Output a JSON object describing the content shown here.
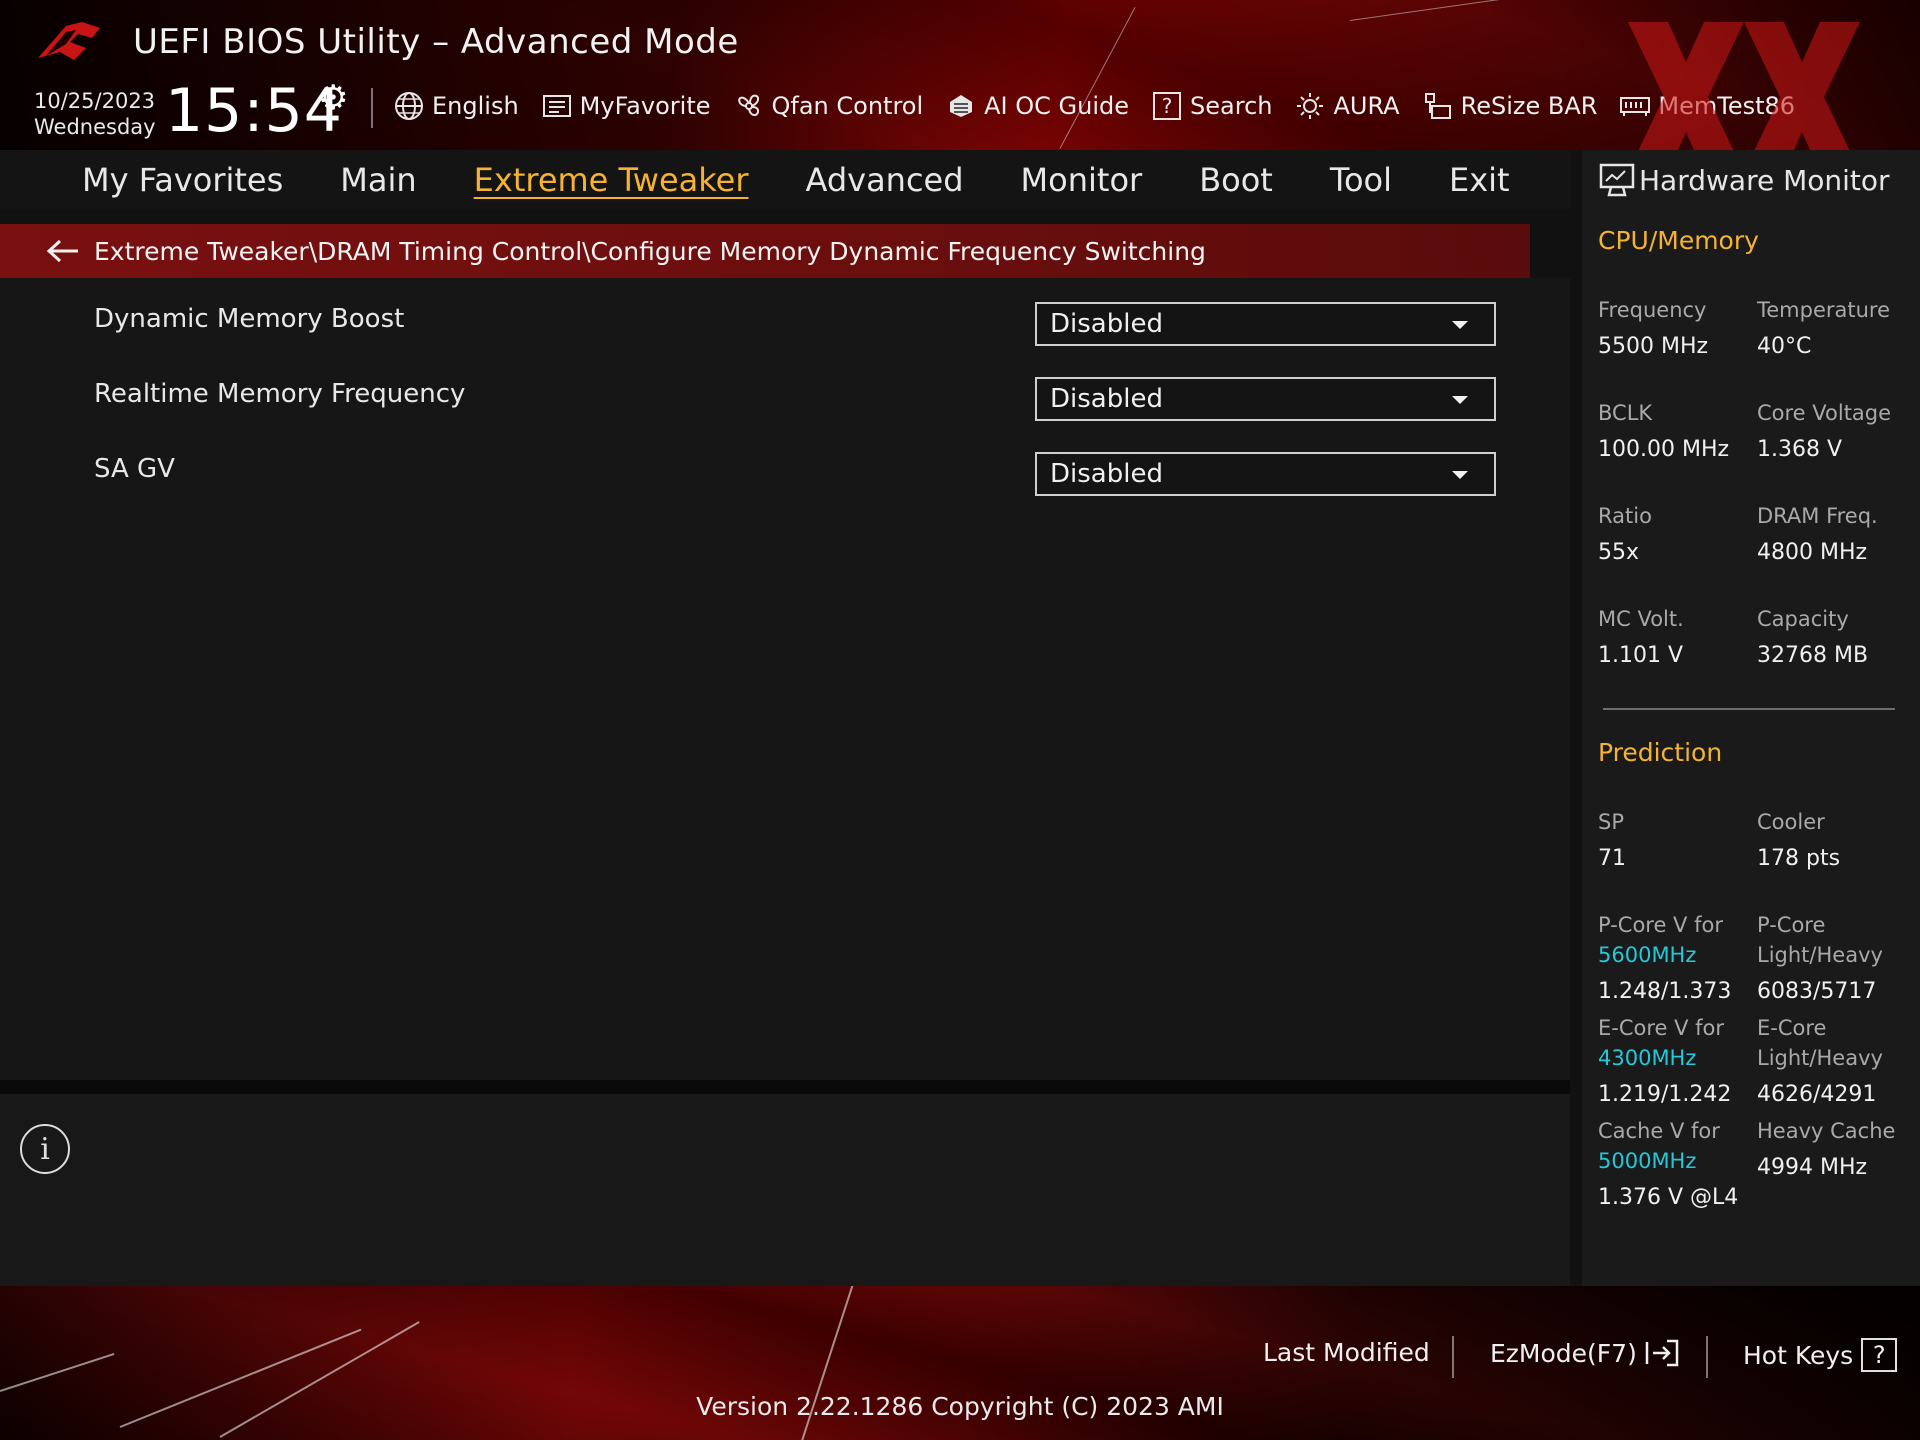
{
  "header": {
    "title": "UEFI BIOS Utility – Advanced Mode",
    "date": "10/25/2023",
    "weekday": "Wednesday",
    "time": "15:54",
    "tools": [
      {
        "label": "English",
        "icon": "globe-icon"
      },
      {
        "label": "MyFavorite",
        "icon": "favorite-list-icon"
      },
      {
        "label": "Qfan Control",
        "icon": "fan-icon"
      },
      {
        "label": "AI OC Guide",
        "icon": "ai-oc-icon"
      },
      {
        "label": "Search",
        "icon": "help-search-icon"
      },
      {
        "label": "AURA",
        "icon": "aura-light-icon"
      },
      {
        "label": "ReSize BAR",
        "icon": "resize-bar-icon"
      },
      {
        "label": "MemTest86",
        "icon": "memtest-icon"
      }
    ]
  },
  "menu": {
    "items": [
      "My Favorites",
      "Main",
      "Extreme Tweaker",
      "Advanced",
      "Monitor",
      "Boot",
      "Tool",
      "Exit"
    ],
    "active": "Extreme Tweaker"
  },
  "breadcrumb": "Extreme Tweaker\\DRAM Timing Control\\Configure Memory Dynamic Frequency Switching",
  "settings": [
    {
      "label": "Dynamic Memory Boost",
      "value": "Disabled"
    },
    {
      "label": "Realtime Memory Frequency",
      "value": "Disabled"
    },
    {
      "label": "SA GV",
      "value": "Disabled"
    }
  ],
  "hardware_monitor": {
    "title": "Hardware Monitor",
    "cpu_memory": {
      "heading": "CPU/Memory",
      "items": [
        {
          "label": "Frequency",
          "value": "5500 MHz"
        },
        {
          "label": "Temperature",
          "value": "40°C"
        },
        {
          "label": "BCLK",
          "value": "100.00 MHz"
        },
        {
          "label": "Core Voltage",
          "value": "1.368 V"
        },
        {
          "label": "Ratio",
          "value": "55x"
        },
        {
          "label": "DRAM Freq.",
          "value": "4800 MHz"
        },
        {
          "label": "MC Volt.",
          "value": "1.101 V"
        },
        {
          "label": "Capacity",
          "value": "32768 MB"
        }
      ]
    },
    "prediction": {
      "heading": "Prediction",
      "sp_label": "SP",
      "sp_value": "71",
      "cooler_label": "Cooler",
      "cooler_value": "178 pts",
      "pcore_v_label": "P-Core V for",
      "pcore_v_freq": "5600MHz",
      "pcore_v_value": "1.248/1.373",
      "pcore_lh_label1": "P-Core",
      "pcore_lh_label2": "Light/Heavy",
      "pcore_lh_value": "6083/5717",
      "ecore_v_label": "E-Core V for",
      "ecore_v_freq": "4300MHz",
      "ecore_v_value": "1.219/1.242",
      "ecore_lh_label1": "E-Core",
      "ecore_lh_label2": "Light/Heavy",
      "ecore_lh_value": "4626/4291",
      "cache_v_label": "Cache V for",
      "cache_v_freq": "5000MHz",
      "cache_v_value": "1.376 V @L4",
      "heavy_cache_label": "Heavy Cache",
      "heavy_cache_value": "4994 MHz"
    }
  },
  "footer": {
    "last_modified": "Last Modified",
    "ezmode": "EzMode(F7)",
    "hot_keys": "Hot Keys",
    "hot_keys_glyph": "?",
    "version": "Version 2.22.1286 Copyright (C) 2023 AMI"
  },
  "colors": {
    "accent": "#f5b331",
    "highlight": "#25c8d8",
    "breadcrumb_bg": "#7a1010"
  }
}
